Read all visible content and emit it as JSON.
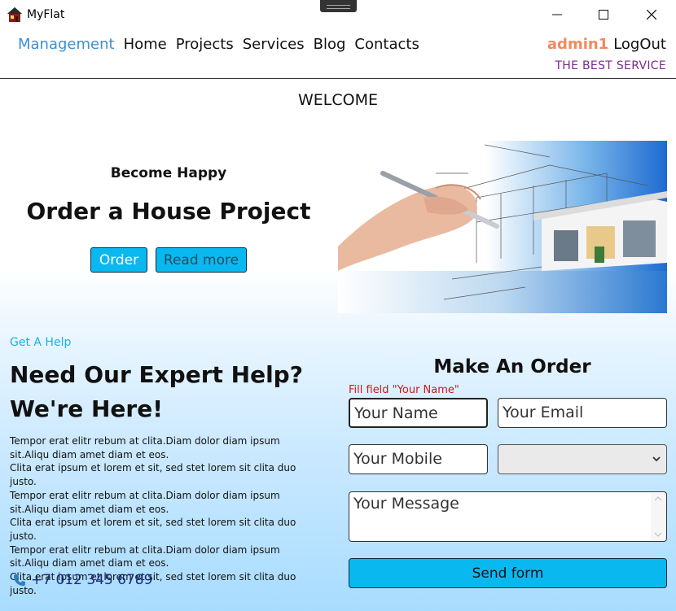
{
  "window": {
    "title": "MyFlat"
  },
  "nav": {
    "items": [
      "Management",
      "Home",
      "Projects",
      "Services",
      "Blog",
      "Contacts"
    ],
    "active_index": 0
  },
  "user": {
    "name": "admin1",
    "logout_label": "LogOut",
    "tagline": "THE BEST SERVICE"
  },
  "page": {
    "welcome": "WELCOME"
  },
  "hero": {
    "subtitle": "Become Happy",
    "title": "Order a House Project",
    "order_label": "Order",
    "read_more_label": "Read more"
  },
  "help": {
    "kicker": "Get A Help",
    "title_line1": "Need Our Expert Help?",
    "title_line2": "We're Here!",
    "paragraphs": [
      "Tempor erat elitr rebum at clita.Diam dolor diam ipsum sit.Aliqu diam amet diam et eos.",
      "Clita erat ipsum et lorem et sit, sed stet lorem sit clita duo justo.",
      "Tempor erat elitr rebum at clita.Diam dolor diam ipsum sit.Aliqu diam amet diam et eos.",
      "Clita erat ipsum et lorem et sit, sed stet lorem sit clita duo justo.",
      "Tempor erat elitr rebum at clita.Diam dolor diam ipsum sit.Aliqu diam amet diam et eos.",
      "Clita erat ipsum et lorem et sit, sed stet lorem sit clita duo justo."
    ],
    "phone": "+7 012 345 6789",
    "phone_icon": "phone-icon"
  },
  "order_form": {
    "title": "Make An Order",
    "error": "Fill field \"Your Name\"",
    "name_placeholder": "Your Name",
    "email_placeholder": "Your Email",
    "mobile_placeholder": "Your Mobile",
    "select_value": "",
    "message_placeholder": "Your Message",
    "submit_label": "Send form"
  },
  "colors": {
    "accent": "#0ab8f0",
    "nav_active": "#3a8fd6",
    "username": "#f08a5d",
    "tagline": "#7b2b8e",
    "error": "#d01818"
  }
}
